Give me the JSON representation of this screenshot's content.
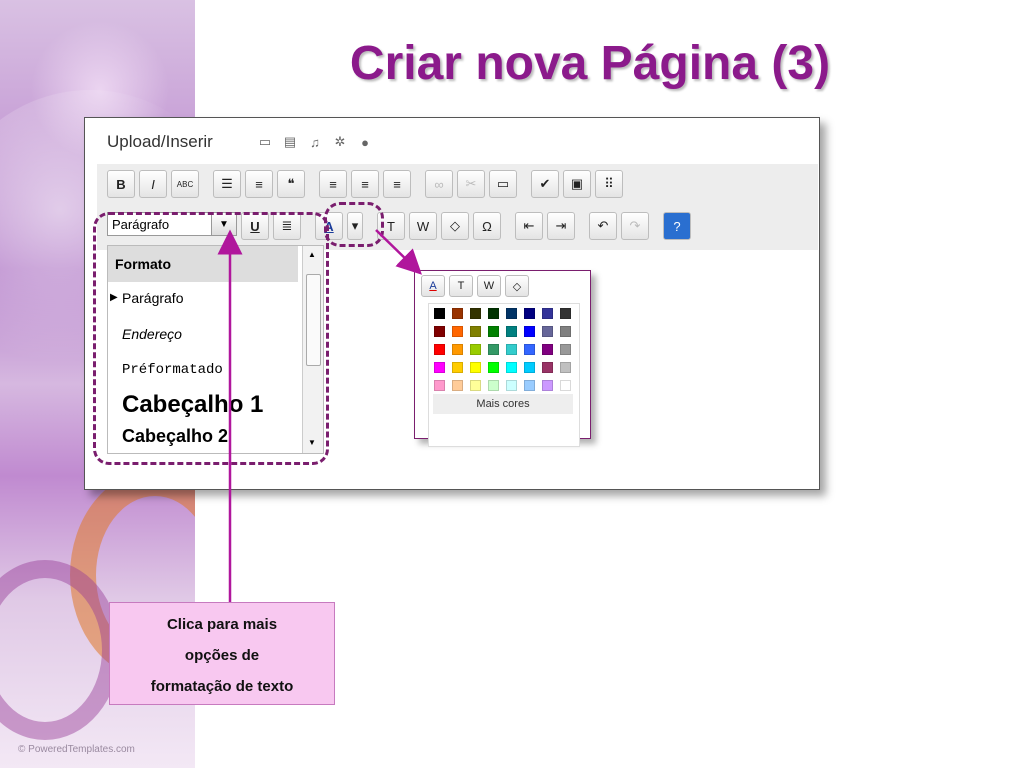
{
  "slide": {
    "title": "Criar nova Página (3)",
    "footer": "© PoweredTemplates.com"
  },
  "editor": {
    "upload_label": "Upload/Inserir",
    "upload_icons": [
      "image-icon",
      "gallery-icon",
      "music-icon",
      "media-icon",
      "circle-icon"
    ],
    "toolbar_row1": [
      {
        "name": "bold-button",
        "label": "B"
      },
      {
        "name": "italic-button",
        "label": "I"
      },
      {
        "name": "strikethrough-button",
        "label": "ABC"
      },
      {
        "name": "bullet-list-button",
        "label": "☰"
      },
      {
        "name": "numbered-list-button",
        "label": "≡"
      },
      {
        "name": "blockquote-button",
        "label": "❝"
      },
      {
        "name": "align-left-button",
        "label": "≡"
      },
      {
        "name": "align-center-button",
        "label": "≡"
      },
      {
        "name": "align-right-button",
        "label": "≡"
      },
      {
        "name": "link-button",
        "label": "∞"
      },
      {
        "name": "unlink-button",
        "label": "✂"
      },
      {
        "name": "more-tag-button",
        "label": "▭"
      },
      {
        "name": "spellcheck-button",
        "label": "✔"
      },
      {
        "name": "fullscreen-button",
        "label": "▣"
      },
      {
        "name": "kitchen-sink-button",
        "label": "⠿"
      }
    ],
    "format_select": {
      "value": "Parágrafo",
      "arrow": "▼"
    },
    "toolbar_row2": [
      {
        "name": "underline-button",
        "label": "U"
      },
      {
        "name": "justify-button",
        "label": "≣"
      },
      {
        "name": "text-color-button",
        "label": "A"
      },
      {
        "name": "text-color-dropdown-button",
        "label": "▾"
      },
      {
        "name": "paste-text-button",
        "label": "T"
      },
      {
        "name": "paste-word-button",
        "label": "W"
      },
      {
        "name": "clear-format-button",
        "label": "◇"
      },
      {
        "name": "special-char-button",
        "label": "Ω"
      },
      {
        "name": "outdent-button",
        "label": "⇤"
      },
      {
        "name": "indent-button",
        "label": "⇥"
      },
      {
        "name": "undo-button",
        "label": "↶"
      },
      {
        "name": "redo-button",
        "label": "↷"
      },
      {
        "name": "help-button",
        "label": "?"
      }
    ],
    "format_menu": {
      "header": "Formato",
      "items": [
        "Parágrafo",
        "Endereço",
        "Préformatado",
        "Cabeçalho 1",
        "Cabeçalho 2"
      ]
    },
    "color_popup": {
      "more_colors": "Mais cores",
      "colors": [
        "#000000",
        "#993300",
        "#333300",
        "#003300",
        "#003366",
        "#000080",
        "#333399",
        "#333333",
        "#800000",
        "#FF6600",
        "#808000",
        "#008000",
        "#008080",
        "#0000FF",
        "#666699",
        "#808080",
        "#FF0000",
        "#FF9900",
        "#99CC00",
        "#339966",
        "#33CCCC",
        "#3366FF",
        "#800080",
        "#999999",
        "#FF00FF",
        "#FFCC00",
        "#FFFF00",
        "#00FF00",
        "#00FFFF",
        "#00CCFF",
        "#993366",
        "#C0C0C0",
        "#FF99CC",
        "#FFCC99",
        "#FFFF99",
        "#CCFFCC",
        "#CCFFFF",
        "#99CCFF",
        "#CC99FF",
        "#FFFFFF"
      ]
    }
  },
  "callout": {
    "line1": "Clica para mais",
    "line2": "opções de",
    "line3": "formatação de texto"
  },
  "colors": {
    "title": "#8b1a8b",
    "dash": "#7a1e6e",
    "arrow": "#b0169c",
    "callout_bg": "#f8c8f0"
  }
}
